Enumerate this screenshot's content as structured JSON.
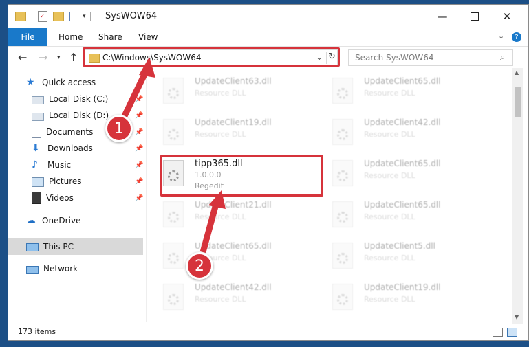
{
  "window": {
    "title": "SysWOW64",
    "minimize_icon": "minimize-icon",
    "maximize_icon": "maximize-icon",
    "close_icon": "close-icon"
  },
  "ribbon": {
    "tabs": [
      "File",
      "Home",
      "Share",
      "View"
    ]
  },
  "navigation": {
    "address": "C:\\Windows\\SysWOW64",
    "search_placeholder": "Search SysWOW64"
  },
  "sidebar": {
    "items": [
      {
        "label": "Quick access",
        "icon": "star-icon"
      },
      {
        "label": "Local Disk (C:)",
        "icon": "drive-icon"
      },
      {
        "label": "Local Disk (D:)",
        "icon": "drive-icon"
      },
      {
        "label": "Documents",
        "icon": "documents-icon"
      },
      {
        "label": "Downloads",
        "icon": "download-icon"
      },
      {
        "label": "Music",
        "icon": "music-icon"
      },
      {
        "label": "Pictures",
        "icon": "pictures-icon"
      },
      {
        "label": "Videos",
        "icon": "videos-icon"
      },
      {
        "label": "OneDrive",
        "icon": "cloud-icon"
      },
      {
        "label": "This PC",
        "icon": "computer-icon"
      },
      {
        "label": "Network",
        "icon": "network-icon"
      }
    ]
  },
  "files": [
    {
      "name": "UpdateClient63.dll",
      "sub": "Resource DLL"
    },
    {
      "name": "UpdateClient65.dll",
      "sub": "Resource DLL"
    },
    {
      "name": "UpdateClient19.dll",
      "sub": "Resource DLL"
    },
    {
      "name": "UpdateClient42.dll",
      "sub": "Resource DLL"
    },
    {
      "name": "tipp365.dll",
      "sub": "1.0.0.0",
      "sub2": "Regedit"
    },
    {
      "name": "UpdateClient65.dll",
      "sub": "Resource DLL"
    },
    {
      "name": "UpdateClient21.dll",
      "sub": "Resource DLL"
    },
    {
      "name": "UpdateClient65.dll",
      "sub": "Resource DLL"
    },
    {
      "name": "UpdateClient65.dll",
      "sub": "Resource DLL"
    },
    {
      "name": "UpdateClient5.dll",
      "sub": "Resource DLL"
    },
    {
      "name": "UpdateClient42.dll",
      "sub": "Resource DLL"
    },
    {
      "name": "UpdateClient19.dll",
      "sub": "Resource DLL"
    }
  ],
  "status": {
    "item_count": "173 items"
  },
  "annotations": {
    "step1": "1",
    "step2": "2",
    "color": "#d6333b"
  }
}
